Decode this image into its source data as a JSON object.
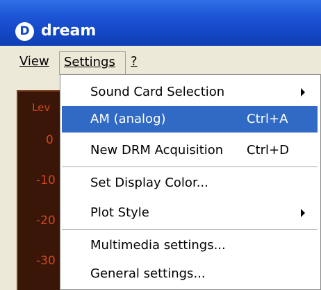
{
  "window": {
    "title": "dream",
    "icon_letter": "D",
    "titlebar_color": "#1447c4"
  },
  "menubar": {
    "items": [
      "View",
      "Settings",
      "?"
    ]
  },
  "background_meter": {
    "labels": [
      "Lev",
      "0",
      "-10",
      "-20",
      "-30"
    ]
  },
  "settings_menu": {
    "highlight_color": "#316ac5",
    "items": [
      {
        "label": "Sound Card Selection",
        "shortcut": "",
        "submenu": true
      },
      {
        "label": "AM (analog)",
        "shortcut": "Ctrl+A",
        "submenu": false,
        "highlighted": true
      },
      {
        "label": "New DRM Acquisition",
        "shortcut": "Ctrl+D",
        "submenu": false
      },
      {
        "label": "Set Display Color...",
        "shortcut": "",
        "submenu": false
      },
      {
        "label": "Plot Style",
        "shortcut": "",
        "submenu": true
      },
      {
        "label": "Multimedia settings...",
        "shortcut": "",
        "submenu": false
      },
      {
        "label": "General settings...",
        "shortcut": "",
        "submenu": false
      }
    ]
  }
}
